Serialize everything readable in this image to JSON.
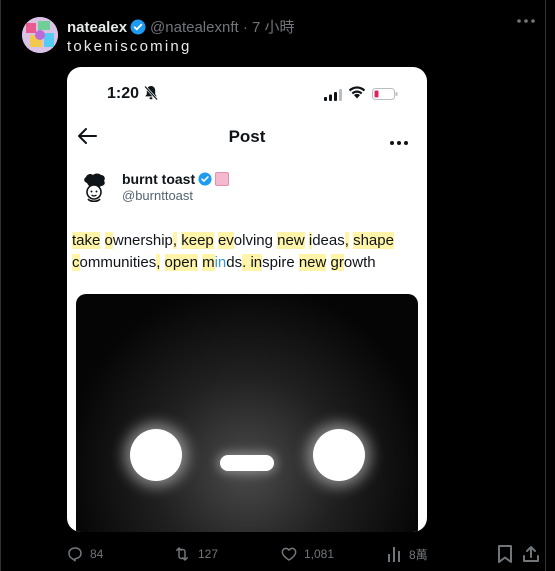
{
  "tweet": {
    "author_name": "natealex",
    "handle": "@natealexnft",
    "time": "7 小時",
    "text": "tokeniscoming"
  },
  "embed": {
    "status_time": "1:20",
    "header_title": "Post",
    "quoted": {
      "name": "burnt toast",
      "handle": "@burnttoast",
      "segments": [
        {
          "t": "take",
          "hl": true
        },
        {
          "t": " "
        },
        {
          "t": "o",
          "hl": true
        },
        {
          "t": "wnership"
        },
        {
          "t": ",",
          "hl": true
        },
        {
          "t": " "
        },
        {
          "t": "keep",
          "hl": true
        },
        {
          "t": " "
        },
        {
          "t": "ev",
          "hl": true
        },
        {
          "t": "olving "
        },
        {
          "t": "new",
          "hl": true
        },
        {
          "t": " "
        },
        {
          "t": "i",
          "hl": true
        },
        {
          "t": "deas"
        },
        {
          "t": ",",
          "hl": true
        },
        {
          "t": " "
        },
        {
          "t": "shape",
          "hl": true
        },
        {
          "t": "\n"
        },
        {
          "t": "c",
          "hl": true
        },
        {
          "t": "ommunities"
        },
        {
          "t": ",",
          "hl": true
        },
        {
          "t": " "
        },
        {
          "t": "open",
          "hl": true
        },
        {
          "t": " "
        },
        {
          "t": "m",
          "hl": true
        },
        {
          "t": "in",
          "blue": true
        },
        {
          "t": "ds"
        },
        {
          "t": ". ",
          "hl": true
        },
        {
          "t": "in",
          "hl": true
        },
        {
          "t": "spire "
        },
        {
          "t": "new",
          "hl": true
        },
        {
          "t": " "
        },
        {
          "t": "gr",
          "hl": true
        },
        {
          "t": "owth"
        }
      ]
    }
  },
  "actions": {
    "replies": "84",
    "reposts": "127",
    "likes": "1,081",
    "views": "8萬"
  },
  "colors": {
    "background": "#000000",
    "muted_text": "#71767b",
    "verified_blue": "#1d9bf0",
    "highlight_yellow": "#fff4a8"
  },
  "icons": [
    "more-icon",
    "verified-badge-icon",
    "bell-off-icon",
    "signal-icon",
    "wifi-icon",
    "battery-icon",
    "back-arrow-icon",
    "reply-icon",
    "repost-icon",
    "like-icon",
    "views-icon",
    "bookmark-icon",
    "share-icon"
  ]
}
